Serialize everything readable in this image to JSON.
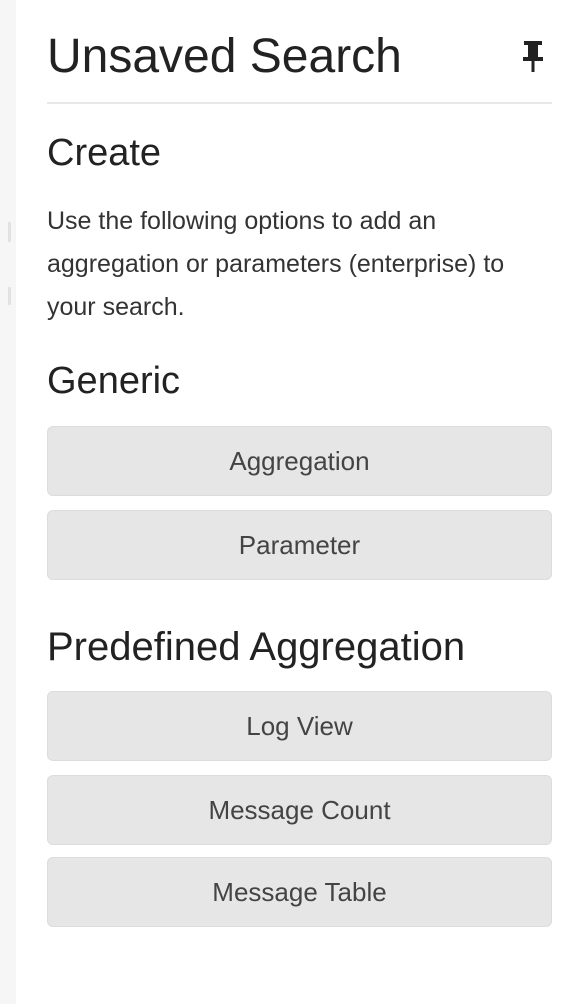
{
  "header": {
    "title": "Unsaved Search",
    "pin_icon": "pin-icon"
  },
  "create": {
    "title": "Create",
    "description": "Use the following options to add an aggregation or parameters (enterprise) to your search."
  },
  "generic": {
    "title": "Generic",
    "buttons": [
      {
        "label": "Aggregation"
      },
      {
        "label": "Parameter"
      }
    ]
  },
  "predefined": {
    "title": "Predefined Aggregation",
    "buttons": [
      {
        "label": "Log View"
      },
      {
        "label": "Message Count"
      },
      {
        "label": "Message Table"
      }
    ]
  },
  "colors": {
    "button_bg": "#e6e6e6",
    "button_text": "#444444",
    "title_text": "#222222",
    "divider": "#e8e8e8"
  }
}
